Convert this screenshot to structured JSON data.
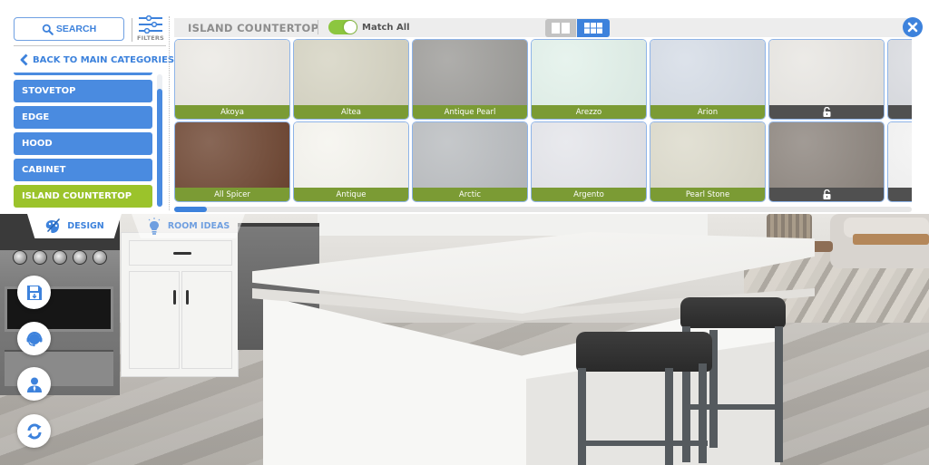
{
  "sidebar": {
    "search_label": "SEARCH",
    "filters_label": "FILTERS",
    "back_label": "BACK TO MAIN CATEGORIES",
    "categories": [
      {
        "label": "STOVETOP",
        "active": false
      },
      {
        "label": "EDGE",
        "active": false
      },
      {
        "label": "HOOD",
        "active": false
      },
      {
        "label": "CABINET",
        "active": false
      },
      {
        "label": "ISLAND COUNTERTOP",
        "active": true
      }
    ]
  },
  "header": {
    "category_title": "ISLAND COUNTERTOP",
    "match_all_label": "Match All",
    "match_all_on": true,
    "view_mode": "grid"
  },
  "materials": [
    {
      "name": "Akoya",
      "locked": false,
      "color": "#ebe9e4"
    },
    {
      "name": "Altea",
      "locked": false,
      "color": "#d5d3c2"
    },
    {
      "name": "Antique Pearl",
      "locked": false,
      "color": "#9d9c99"
    },
    {
      "name": "Arezzo",
      "locked": false,
      "color": "#e2f1ea"
    },
    {
      "name": "Arion",
      "locked": false,
      "color": "#d5dce6"
    },
    {
      "name": "",
      "locked": true,
      "color": "#e8e6e2"
    },
    {
      "name": "",
      "locked": true,
      "color": "#d9dbe0"
    },
    {
      "name": "All Spicer",
      "locked": false,
      "color": "#6e4632"
    },
    {
      "name": "Antique",
      "locked": false,
      "color": "#f5f4ee"
    },
    {
      "name": "Arctic",
      "locked": false,
      "color": "#b9bcbf"
    },
    {
      "name": "Argento",
      "locked": false,
      "color": "#e4e5ea"
    },
    {
      "name": "Pearl Stone",
      "locked": false,
      "color": "#dcdacb"
    },
    {
      "name": "",
      "locked": true,
      "color": "#8d857e"
    },
    {
      "name": "",
      "locked": true,
      "color": "#f3f3f3"
    }
  ],
  "scroll": {
    "grid_horizontal_position": 0.0
  },
  "tabs": {
    "design_label": "DESIGN",
    "room_ideas_label": "ROOM IDEAS",
    "active": "design"
  },
  "actions": [
    {
      "name": "save-design",
      "icon": "floppy-disk-icon"
    },
    {
      "name": "support",
      "icon": "headset-icon"
    },
    {
      "name": "contact-agent",
      "icon": "agent-icon"
    },
    {
      "name": "reset",
      "icon": "refresh-icon"
    }
  ],
  "colors": {
    "accent_blue": "#3d82dc",
    "active_green": "#9bc32b",
    "label_green": "#7b9b34",
    "locked_gray": "#505050"
  }
}
